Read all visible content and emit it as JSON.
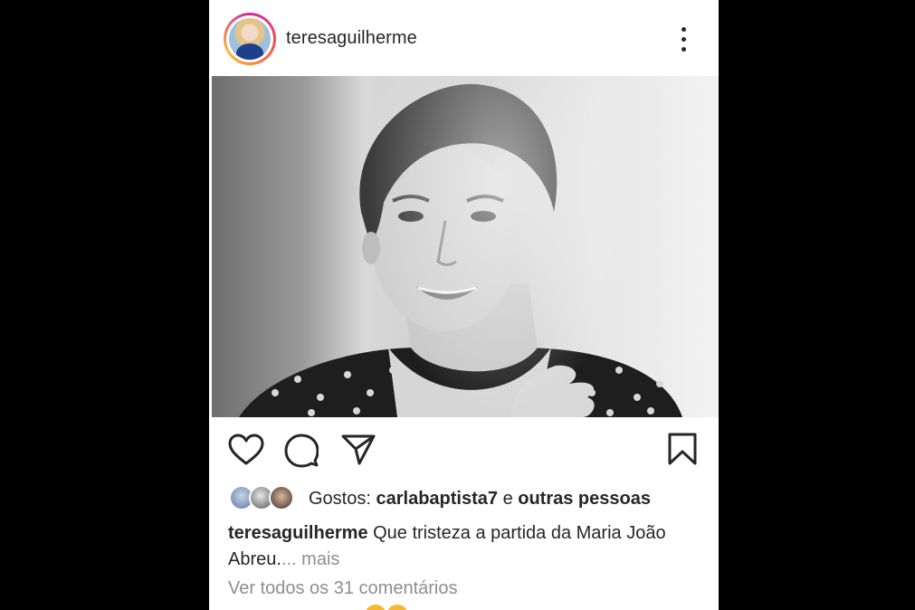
{
  "post": {
    "username": "teresaguilherme",
    "likes": {
      "prefix": "Gostos:",
      "first_liker": "carlabaptista7",
      "connector": "e",
      "others": "outras pessoas"
    },
    "caption": {
      "text": "Que tristeza a partida da Maria João Abreu.",
      "ellipsis": "...",
      "more": "mais"
    },
    "comments_link": "Ver todos os 31 comentários"
  },
  "icons": {
    "more": "more-vertical-icon",
    "like": "heart-icon",
    "comment": "comment-icon",
    "share": "send-icon",
    "save": "bookmark-icon"
  },
  "colors": {
    "text": "#262626",
    "muted": "#8e8e8e",
    "background": "#ffffff"
  }
}
